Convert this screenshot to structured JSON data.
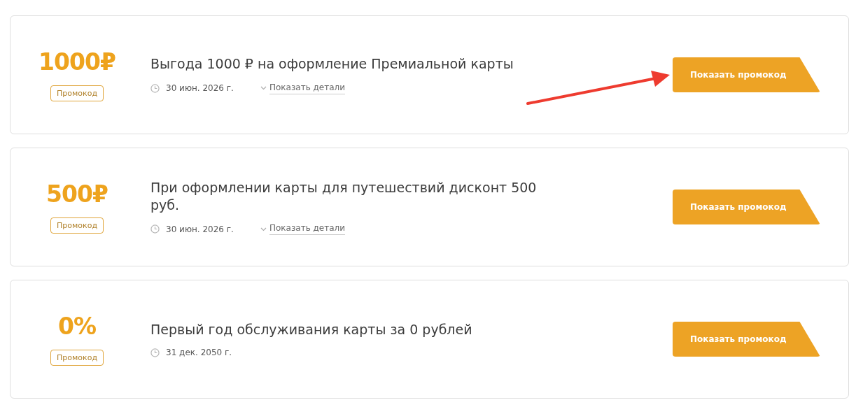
{
  "offers": [
    {
      "value": "1000₽",
      "tag": "Промокод",
      "title": "Выгода 1000 ₽ на оформление Премиальной карты",
      "expires": "30 июн. 2026 г.",
      "details_link": "Показать детали",
      "button": "Показать промокод"
    },
    {
      "value": "500₽",
      "tag": "Промокод",
      "title": "При оформлении карты для путешествий дисконт 500 руб.",
      "expires": "30 июн. 2026 г.",
      "details_link": "Показать детали",
      "button": "Показать промокод"
    },
    {
      "value": "0%",
      "tag": "Промокод",
      "title": "Первый год обслуживания карты за 0 рублей",
      "expires": "31 дек. 2050 г.",
      "button": "Показать промокод"
    }
  ]
}
